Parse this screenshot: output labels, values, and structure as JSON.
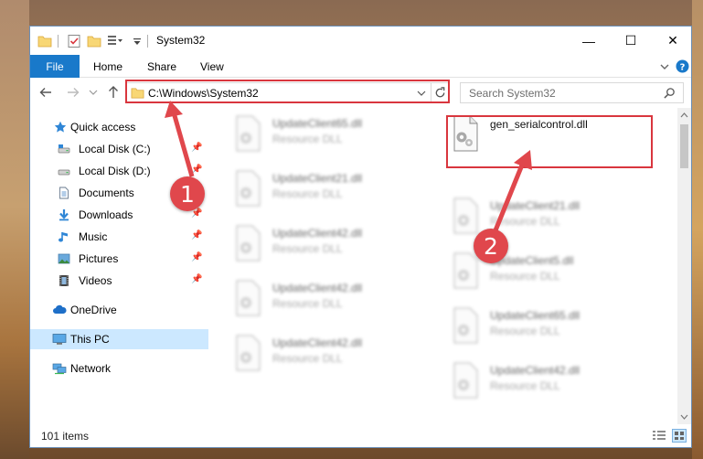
{
  "window": {
    "title": "System32"
  },
  "ribbon": {
    "file": "File",
    "tabs": [
      "Home",
      "Share",
      "View"
    ]
  },
  "controls": {
    "minimize": "—",
    "maximize": "☐",
    "close": "✕"
  },
  "navigation": {
    "address": "C:\\Windows\\System32",
    "search_placeholder": "Search System32"
  },
  "sidebar": {
    "items": [
      {
        "label": "Quick access",
        "icon": "star-icon"
      },
      {
        "label": "Local Disk (C:)",
        "icon": "drive-icon",
        "pinned": true
      },
      {
        "label": "Local Disk (D:)",
        "icon": "drive-icon",
        "pinned": true
      },
      {
        "label": "Documents",
        "icon": "documents-icon",
        "pinned": true
      },
      {
        "label": "Downloads",
        "icon": "downloads-icon",
        "pinned": true
      },
      {
        "label": "Music",
        "icon": "music-icon",
        "pinned": true
      },
      {
        "label": "Pictures",
        "icon": "pictures-icon",
        "pinned": true
      },
      {
        "label": "Videos",
        "icon": "videos-icon",
        "pinned": true
      },
      {
        "label": "OneDrive",
        "icon": "cloud-icon"
      },
      {
        "label": "This PC",
        "icon": "computer-icon",
        "selected": true
      },
      {
        "label": "Network",
        "icon": "network-icon"
      }
    ]
  },
  "files": {
    "highlighted": {
      "name": "gen_serialcontrol.dll"
    },
    "left": [
      {
        "name": "UpdateClient65.dll",
        "type": "Resource DLL"
      },
      {
        "name": "UpdateClient21.dll",
        "type": "Resource DLL"
      },
      {
        "name": "UpdateClient42.dll",
        "type": "Resource DLL"
      },
      {
        "name": "UpdateClient42.dll",
        "type": "Resource DLL"
      },
      {
        "name": "UpdateClient42.dll",
        "type": "Resource DLL"
      }
    ],
    "right": [
      {
        "name": "UpdateClient21.dll",
        "type": "Resource DLL"
      },
      {
        "name": "UpdateClient5.dll",
        "type": "Resource DLL"
      },
      {
        "name": "UpdateClient65.dll",
        "type": "Resource DLL"
      },
      {
        "name": "UpdateClient42.dll",
        "type": "Resource DLL"
      }
    ]
  },
  "status": {
    "count": "101 items"
  },
  "annotations": {
    "step1": "1",
    "step2": "2"
  },
  "colors": {
    "accent": "#1979ca",
    "highlight": "#d9363e",
    "badge": "#e0474c",
    "selected": "#cce8ff"
  }
}
